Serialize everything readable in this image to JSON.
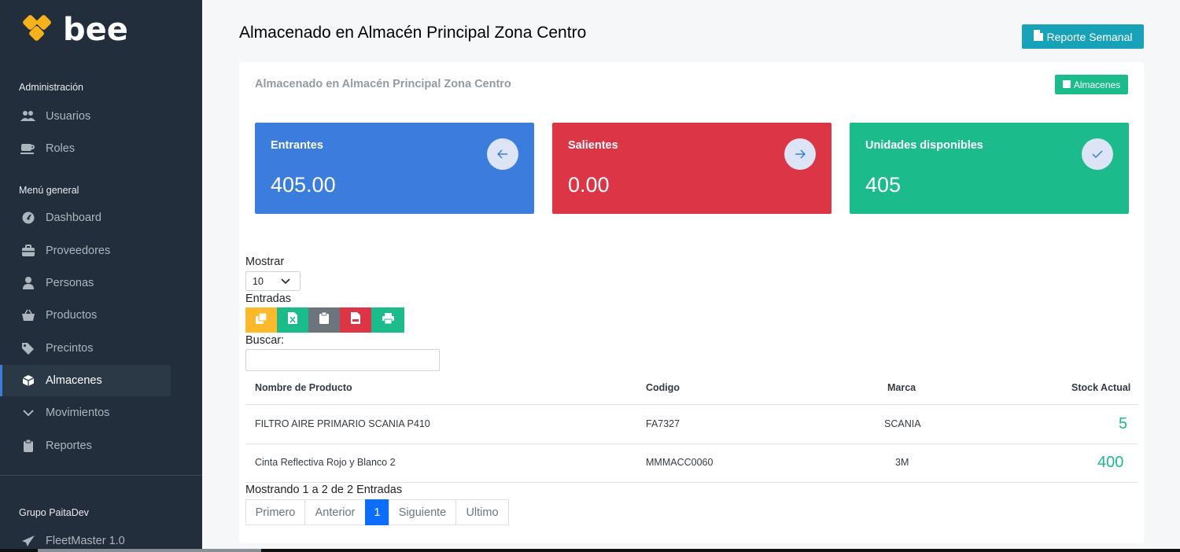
{
  "brand": {
    "name": "bee",
    "color": "#f6b21a"
  },
  "sidebar": {
    "sections": [
      {
        "header": "Administración",
        "items": [
          {
            "label": "Usuarios",
            "icon": "users-icon"
          },
          {
            "label": "Roles",
            "icon": "coffee-icon"
          }
        ]
      },
      {
        "header": "Menú general",
        "items": [
          {
            "label": "Dashboard",
            "icon": "gauge-icon"
          },
          {
            "label": "Proveedores",
            "icon": "briefcase-icon"
          },
          {
            "label": "Personas",
            "icon": "user-icon"
          },
          {
            "label": "Productos",
            "icon": "basket-icon"
          },
          {
            "label": "Precintos",
            "icon": "tags-icon"
          },
          {
            "label": "Almacenes",
            "icon": "box-icon",
            "active": true
          },
          {
            "label": "Movimientos",
            "icon": "chevron-down-icon"
          },
          {
            "label": "Reportes",
            "icon": "clipboard-icon"
          }
        ]
      },
      {
        "header": "Grupo PaitaDev",
        "items": [
          {
            "label": "FleetMaster 1.0",
            "icon": "paper-plane-icon"
          }
        ]
      }
    ]
  },
  "header": {
    "title": "Almacenado en Almacén Principal Zona Centro",
    "report_button": "Reporte Semanal"
  },
  "card": {
    "title": "Almacenado en Almacén Principal Zona Centro",
    "warehouses_button": "Almacenes"
  },
  "stats": [
    {
      "label": "Entrantes",
      "value": "405.00",
      "color": "#3b7ddd",
      "icon": "arrow-left-icon"
    },
    {
      "label": "Salientes",
      "value": "0.00",
      "color": "#dc3545",
      "icon": "arrow-right-icon"
    },
    {
      "label": "Unidades disponibles",
      "value": "405",
      "color": "#1cbb8c",
      "icon": "check-icon"
    }
  ],
  "table_controls": {
    "show_label": "Mostrar",
    "page_size": "10",
    "entries_label": "Entradas",
    "search_label": "Buscar:",
    "search_value": ""
  },
  "export_buttons": [
    {
      "icon": "copy-icon",
      "color": "#fcb92c"
    },
    {
      "icon": "excel-icon",
      "color": "#1cbb8c"
    },
    {
      "icon": "clipboard-icon",
      "color": "#6c757d"
    },
    {
      "icon": "pdf-icon",
      "color": "#dc3545"
    },
    {
      "icon": "print-icon",
      "color": "#1cbb8c"
    }
  ],
  "table": {
    "columns": [
      "Nombre de Producto",
      "Codigo",
      "Marca",
      "Stock Actual"
    ],
    "rows": [
      [
        "FILTRO AIRE PRIMARIO SCANIA P410",
        "FA7327",
        "SCANIA",
        "5"
      ],
      [
        "Cinta Reflectiva Rojo y Blanco 2",
        "MMMACC0060",
        "3M",
        "400"
      ]
    ]
  },
  "footer": {
    "info": "Mostrando 1 a 2 de 2 Entradas",
    "pagination": [
      "Primero",
      "Anterior",
      "1",
      "Siguiente",
      "Ultimo"
    ],
    "current_page": "1"
  }
}
